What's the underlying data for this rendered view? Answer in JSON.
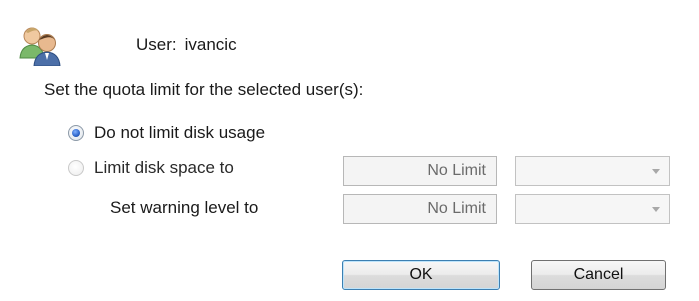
{
  "user": {
    "prefix": "User:",
    "name": "ivancic",
    "icon": "users-icon"
  },
  "instruction": "Set the quota limit for the selected user(s):",
  "options": {
    "no_limit": {
      "label": "Do not limit disk usage",
      "selected": true
    },
    "limit": {
      "label": "Limit disk space to",
      "selected": false
    }
  },
  "limit_value": "No Limit",
  "warning_label": "Set warning level to",
  "warning_value": "No Limit",
  "buttons": {
    "ok": "OK",
    "cancel": "Cancel"
  },
  "colors": {
    "accent": "#3c7fb1",
    "radio_selected": "#2c63c8"
  }
}
